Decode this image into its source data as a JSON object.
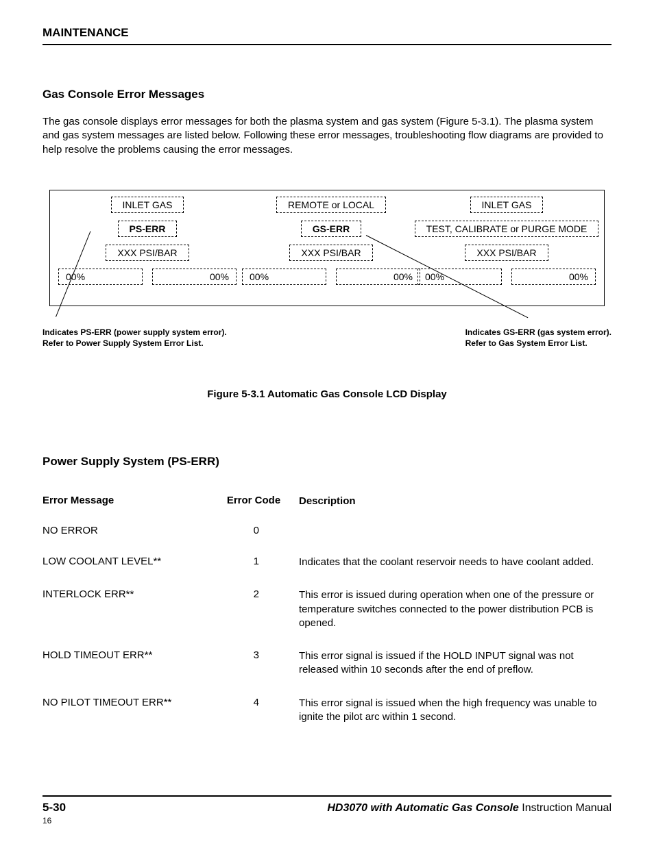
{
  "header": {
    "title": "MAINTENANCE"
  },
  "section1": {
    "heading": "Gas Console Error Messages",
    "body": "The gas console displays error messages for both the plasma system and gas system (Figure 5-3.1). The plasma system and gas system messages are listed below. Following these error messages, troubleshooting flow diagrams are provided to help resolve the problems causing the error messages."
  },
  "diagram": {
    "cols": [
      {
        "r1": "INLET GAS",
        "r2": "PS-ERR",
        "r3": "XXX PSI/BAR",
        "p1": "00%",
        "p2": "00%"
      },
      {
        "r1": "REMOTE or LOCAL",
        "r2": "GS-ERR",
        "r3": "XXX PSI/BAR",
        "p1": "00%",
        "p2": "00%"
      },
      {
        "r1": "INLET GAS",
        "r2": "TEST, CALIBRATE or PURGE MODE",
        "r3": "XXX PSI/BAR",
        "p1": "00%",
        "p2": "00%"
      }
    ],
    "callout_left_l1": "Indicates PS-ERR (power supply system error).",
    "callout_left_l2": "Refer to Power Supply System Error List.",
    "callout_right_l1": "Indicates GS-ERR (gas system error).",
    "callout_right_l2": "Refer to Gas System Error List.",
    "caption": "Figure 5-3.1    Automatic Gas Console LCD Display"
  },
  "section2": {
    "heading": "Power Supply System (PS-ERR)",
    "columns": {
      "msg": "Error Message",
      "code": "Error Code",
      "desc": "Description"
    },
    "rows": [
      {
        "msg": "NO ERROR",
        "code": "0",
        "desc": ""
      },
      {
        "msg": "LOW COOLANT LEVEL**",
        "code": "1",
        "desc": "Indicates that the coolant reservoir needs to have coolant added."
      },
      {
        "msg": "INTERLOCK ERR**",
        "code": "2",
        "desc": "This error is issued during operation when one of the pressure or temperature switches connected to the power distribution PCB is opened."
      },
      {
        "msg": "HOLD TIMEOUT ERR**",
        "code": "3",
        "desc": "This error signal is issued if the HOLD INPUT signal was not released within 10 seconds after the end of preflow."
      },
      {
        "msg": "NO PILOT TIMEOUT ERR**",
        "code": "4",
        "desc": "This error signal is issued when the high frequency was unable to ignite the pilot arc within 1 second."
      }
    ]
  },
  "footer": {
    "page_no": "5-30",
    "machine": "HD3070 with Automatic Gas Console",
    "manual": "  Instruction Manual",
    "sub": "16"
  }
}
